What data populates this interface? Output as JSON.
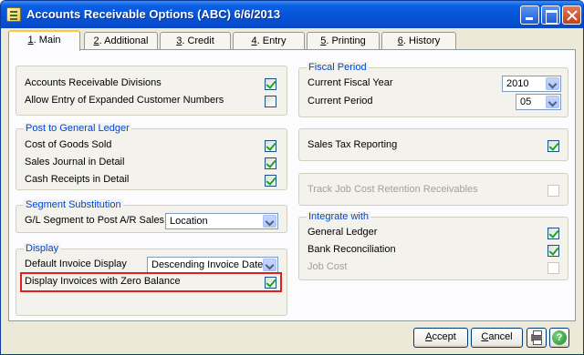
{
  "window": {
    "title": "Accounts Receivable Options (ABC) 6/6/2013"
  },
  "tabs": [
    {
      "key": "1",
      "label": ". Main"
    },
    {
      "key": "2",
      "label": ". Additional"
    },
    {
      "key": "3",
      "label": ". Credit"
    },
    {
      "key": "4",
      "label": ". Entry"
    },
    {
      "key": "5",
      "label": ". Printing"
    },
    {
      "key": "6",
      "label": ". History"
    }
  ],
  "main": {
    "top_checks": {
      "divisions": {
        "label": "Accounts Receivable Divisions",
        "checked": true
      },
      "expanded_numbers": {
        "label": "Allow Entry of Expanded Customer Numbers",
        "checked": false
      }
    },
    "post_gl": {
      "title": "Post to General Ledger",
      "cogs": {
        "label": "Cost of Goods Sold",
        "checked": true
      },
      "sales_journal": {
        "label": "Sales Journal in Detail",
        "checked": true
      },
      "cash_receipts": {
        "label": "Cash Receipts in Detail",
        "checked": true
      }
    },
    "segment": {
      "title": "Segment Substitution",
      "label": "G/L Segment to Post A/R Sales",
      "value": "Location"
    },
    "display": {
      "title": "Display",
      "default_label": "Default Invoice Display",
      "default_value": "Descending Invoice Date",
      "zero_balance": {
        "label": "Display Invoices with Zero Balance",
        "checked": true
      }
    },
    "fiscal": {
      "title": "Fiscal Period",
      "year_label": "Current Fiscal Year",
      "year_value": "2010",
      "period_label": "Current Period",
      "period_value": "05"
    },
    "sales_tax": {
      "label": "Sales Tax Reporting",
      "checked": true
    },
    "job_cost": {
      "label": "Track Job Cost Retention Receivables",
      "checked": false,
      "enabled": false
    },
    "integrate": {
      "title": "Integrate with",
      "gl": {
        "label": "General Ledger",
        "checked": true
      },
      "bank": {
        "label": "Bank Reconciliation",
        "checked": true
      },
      "jobcost": {
        "label": "Job Cost",
        "checked": false,
        "enabled": false
      }
    }
  },
  "buttons": {
    "accept_key": "A",
    "accept_rest": "ccept",
    "cancel_key": "C",
    "cancel_rest": "ancel"
  },
  "icons": {
    "print": "printer-icon",
    "help": "help-icon"
  },
  "colors": {
    "group_title": "#0046d5",
    "check_mark": "#21a121",
    "highlight": "#e0201c",
    "titlebar": "#0553d9"
  }
}
